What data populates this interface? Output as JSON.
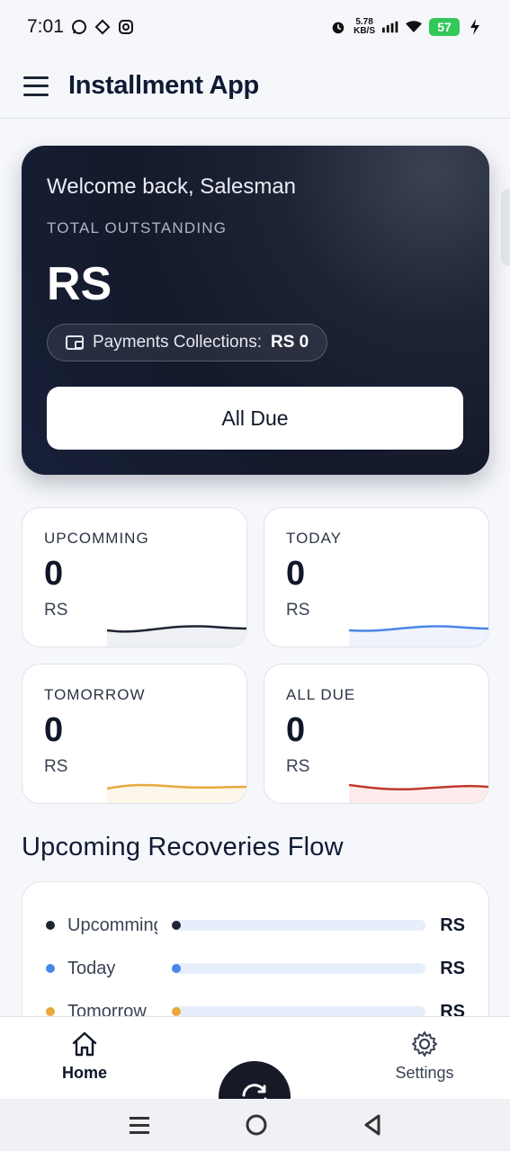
{
  "status_bar": {
    "time": "7:01",
    "net_speed": "5.78",
    "net_unit": "KB/S",
    "battery": "57",
    "icons": [
      "whatsapp-icon",
      "diamond-app-icon",
      "instagram-icon",
      "alarm-icon",
      "signal-icon",
      "wifi-icon",
      "battery-icon",
      "charging-icon"
    ]
  },
  "app_bar": {
    "title": "Installment App",
    "menu_icon": "hamburger-menu-icon"
  },
  "hero": {
    "welcome": "Welcome back, Salesman",
    "label": "TOTAL OUTSTANDING",
    "amount": "RS",
    "chip_label": "Payments Collections:",
    "chip_value": "RS 0",
    "button": "All Due"
  },
  "stats": [
    {
      "title": "UPCOMMING",
      "value": "0",
      "unit": "RS",
      "color": "#1e2433"
    },
    {
      "title": "TODAY",
      "value": "0",
      "unit": "RS",
      "color": "#4a86e8"
    },
    {
      "title": "TOMORROW",
      "value": "0",
      "unit": "RS",
      "color": "#e8a93a"
    },
    {
      "title": "ALL DUE",
      "value": "0",
      "unit": "RS",
      "color": "#c0392b"
    }
  ],
  "section": {
    "title": "Upcoming Recoveries Flow",
    "rows": [
      {
        "label": "Upcomming",
        "value": "RS",
        "color": "#1e2433"
      },
      {
        "label": "Today",
        "value": "RS",
        "color": "#4a86e8"
      },
      {
        "label": "Tomorrow",
        "value": "RS",
        "color": "#e8a93a"
      }
    ]
  },
  "bottom_nav": {
    "home": "Home",
    "settings": "Settings"
  }
}
